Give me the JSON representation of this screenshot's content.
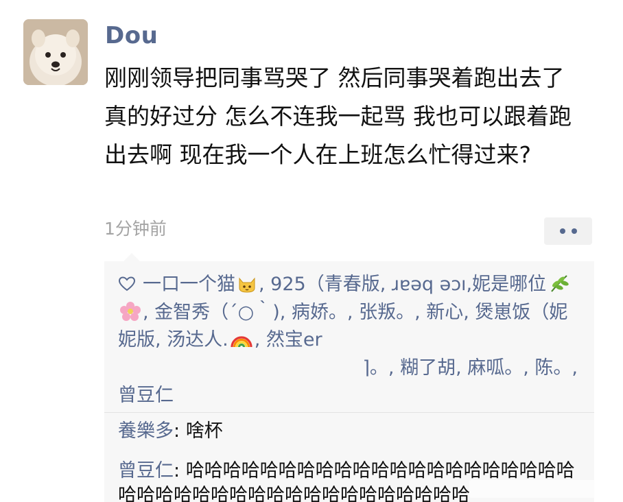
{
  "post": {
    "username": "Dou",
    "text": "刚刚领导把同事骂哭了 然后同事哭着跑出去了 真的好过分 怎么不连我一起骂 我也可以跟着跑出去啊 现在我一个人在上班怎么忙得过来?",
    "timestamp": "1分钟前"
  },
  "likes": {
    "icon": "heart-outline-icon",
    "part1": "一口一个猫",
    "part2": ", 925（青春版, ɹɐǝq ǝɔı,妮是哪位",
    "part3": ", 金智秀（´○｀), 病娇。, 张叛。, 新心, 煲崽饭（妮妮版, 汤达人.",
    "part4": ", 然宝er",
    "part5": "　　　　　　　　　　　　　 ⌉。, 糊了胡, 麻呱。, 陈。, 曾豆仁"
  },
  "comments": [
    {
      "author": "養樂多",
      "text": "啥杯"
    },
    {
      "author": "曾豆仁",
      "text": "哈哈哈哈哈哈哈哈哈哈哈哈哈哈哈哈哈哈哈哈哈哈哈哈哈哈哈哈哈哈哈哈哈哈哈哈哈哈哈哈"
    }
  ],
  "colors": {
    "link": "#57698f",
    "text": "#111111",
    "meta": "#a4a4a4",
    "comment_bg": "#f7f7f7"
  }
}
